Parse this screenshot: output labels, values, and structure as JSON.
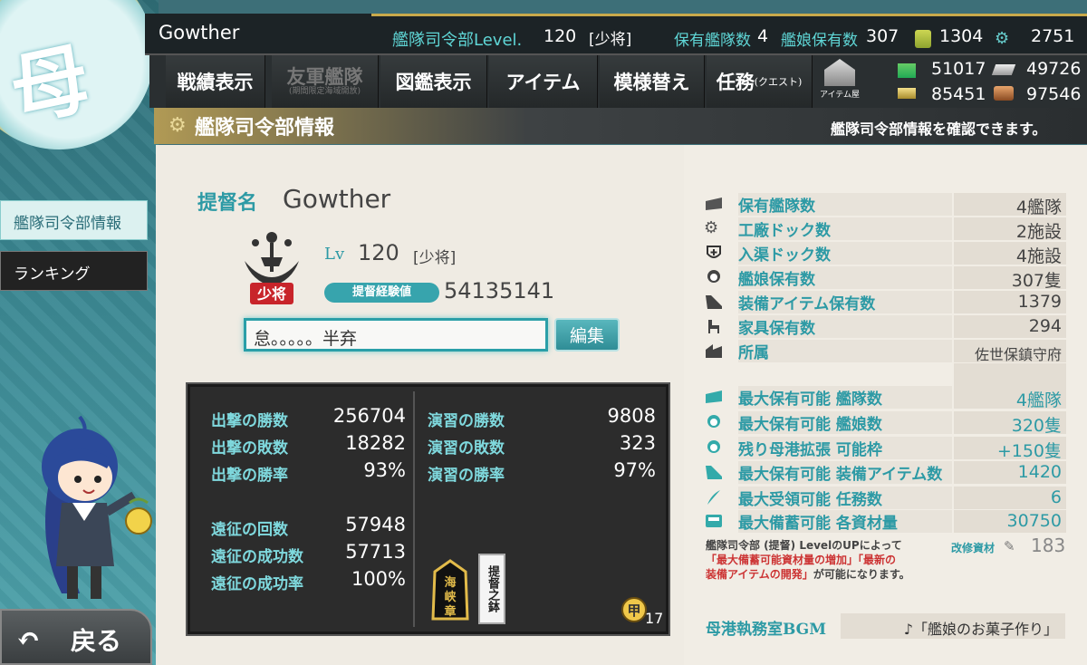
{
  "header": {
    "username": "Gowther",
    "hq_level_label": "艦隊司令部Level.",
    "hq_level_value": "120",
    "hq_rank": "[少将]",
    "fleets_label": "保有艦隊数",
    "fleets_value": "4",
    "ships_label": "艦娘保有数",
    "ships_value": "307",
    "bucket_value": "1304",
    "devmat_value": "2751"
  },
  "resources": {
    "fuel": "51017",
    "ammo": "49726",
    "steel": "85451",
    "bauxite": "97546"
  },
  "menu": {
    "items": [
      "戦績表示",
      "友軍艦隊",
      "図鑑表示",
      "アイテム",
      "模様替え",
      "任務"
    ],
    "friend_fleet_sub": "(期間限定海域開放)",
    "quest_sub": "(クエスト)",
    "item_shop_label": "アイテム屋"
  },
  "titlebar": {
    "title": "艦隊司令部情報",
    "description": "艦隊司令部情報を確認できます。"
  },
  "sidebar": {
    "items": [
      {
        "label": "艦隊司令部情報"
      },
      {
        "label": "ランキング"
      }
    ],
    "back_label": "戻る"
  },
  "profile": {
    "admiral_label": "提督名",
    "admiral_name": "Gowther",
    "rank_badge_text": "少将",
    "lv_label": "Lv",
    "lv_value": "120",
    "rank": "[少将]",
    "exp_label": "提督経験値",
    "exp_value": "54135141",
    "comment": "怠。。。。。半弃",
    "edit_label": "編集"
  },
  "stats": {
    "left": [
      {
        "label": "出撃の勝数",
        "value": "256704"
      },
      {
        "label": "出撃の敗数",
        "value": "18282"
      },
      {
        "label": "出撃の勝率",
        "value": "93%"
      },
      {
        "label": "遠征の回数",
        "value": "57948"
      },
      {
        "label": "遠征の成功数",
        "value": "57713"
      },
      {
        "label": "遠征の成功率",
        "value": "100%"
      }
    ],
    "right": [
      {
        "label": "演習の勝数",
        "value": "9808"
      },
      {
        "label": "演習の敗数",
        "value": "323"
      },
      {
        "label": "演習の勝率",
        "value": "97%"
      }
    ],
    "medal1_text": "海峡章",
    "medal2_text": "提督之鉢",
    "medal3_text": "甲",
    "medal3_count": "17"
  },
  "info": {
    "rows": [
      {
        "icon": "fleet-icon",
        "label": "保有艦隊数",
        "value": "4艦隊"
      },
      {
        "icon": "gear-icon",
        "label": "工廠ドック数",
        "value": "2施設"
      },
      {
        "icon": "repair-icon",
        "label": "入渠ドック数",
        "value": "4施設"
      },
      {
        "icon": "shipgirl-icon",
        "label": "艦娘保有数",
        "value": "307隻"
      },
      {
        "icon": "equipment-icon",
        "label": "装備アイテム保有数",
        "value": "1379"
      },
      {
        "icon": "furniture-icon",
        "label": "家具保有数",
        "value": "294"
      },
      {
        "icon": "base-icon",
        "label": "所属",
        "value": "佐世保鎮守府"
      }
    ],
    "max_rows": [
      {
        "icon": "fleet-icon",
        "label": "最大保有可能 艦隊数",
        "value": "4艦隊"
      },
      {
        "icon": "shipgirl-icon",
        "label": "最大保有可能 艦娘数",
        "value": "320隻"
      },
      {
        "icon": "shipgirl-icon",
        "label": "残り母港拡張 可能枠",
        "value": "+150隻"
      },
      {
        "icon": "equipment-icon",
        "label": "最大保有可能 装備アイテム数",
        "value": "1420"
      },
      {
        "icon": "quill-icon",
        "label": "最大受領可能 任務数",
        "value": "6"
      },
      {
        "icon": "storage-icon",
        "label": "最大備蓄可能 各資材量",
        "value": "30750"
      }
    ],
    "note_line1": "艦隊司令部 (提督) LevelのUPによって",
    "note_line2": "「最大備蓄可能資材量の増加」「最新の",
    "note_line3": "装備アイテムの開発」",
    "note_line3b": "が可能になります。",
    "kaishu_label": "改修資材",
    "kaishu_value": "183",
    "bgm_label": "母港執務室BGM",
    "bgm_value": "♪「艦娘のお菓子作り」"
  },
  "colors": {
    "accent": "#2d9aa5",
    "topbar": "#1c2326",
    "panel": "#efebe3"
  }
}
